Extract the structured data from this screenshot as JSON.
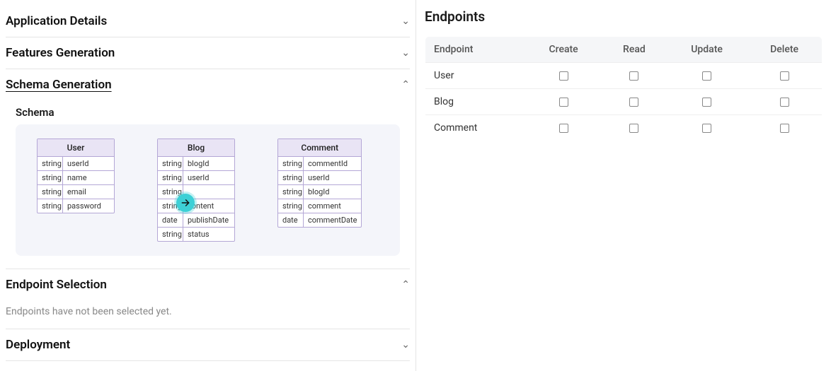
{
  "leftPanel": {
    "sections": {
      "appDetails": {
        "title": "Application Details",
        "expanded": false
      },
      "featuresGen": {
        "title": "Features Generation",
        "expanded": false
      },
      "schemaGen": {
        "title": "Schema Generation",
        "expanded": true,
        "subtitle": "Schema"
      },
      "endpointSel": {
        "title": "Endpoint Selection",
        "expanded": true,
        "note": "Endpoints have not been selected yet."
      },
      "deployment": {
        "title": "Deployment",
        "expanded": false
      }
    },
    "schema": {
      "entities": [
        {
          "name": "User",
          "fields": [
            {
              "type": "string",
              "name": "userId"
            },
            {
              "type": "string",
              "name": "name"
            },
            {
              "type": "string",
              "name": "email"
            },
            {
              "type": "string",
              "name": "password"
            }
          ]
        },
        {
          "name": "Blog",
          "fields": [
            {
              "type": "string",
              "name": "blogId"
            },
            {
              "type": "string",
              "name": "userId"
            },
            {
              "type": "string",
              "name": ""
            },
            {
              "type": "string",
              "name": "content"
            },
            {
              "type": "date",
              "name": "publishDate"
            },
            {
              "type": "string",
              "name": "status"
            }
          ]
        },
        {
          "name": "Comment",
          "fields": [
            {
              "type": "string",
              "name": "commentId"
            },
            {
              "type": "string",
              "name": "userId"
            },
            {
              "type": "string",
              "name": "blogId"
            },
            {
              "type": "string",
              "name": "comment"
            },
            {
              "type": "date",
              "name": "commentDate"
            }
          ]
        }
      ]
    }
  },
  "rightPanel": {
    "title": "Endpoints",
    "columns": {
      "c0": "Endpoint",
      "c1": "Create",
      "c2": "Read",
      "c3": "Update",
      "c4": "Delete"
    },
    "rows": [
      {
        "endpoint": "User",
        "create": false,
        "read": false,
        "update": false,
        "delete": false
      },
      {
        "endpoint": "Blog",
        "create": false,
        "read": false,
        "update": false,
        "delete": false
      },
      {
        "endpoint": "Comment",
        "create": false,
        "read": false,
        "update": false,
        "delete": false
      }
    ]
  }
}
